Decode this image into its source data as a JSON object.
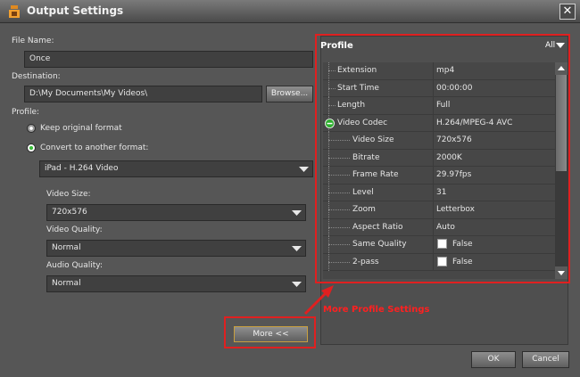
{
  "window": {
    "title": "Output Settings",
    "close_label": "✕"
  },
  "form": {
    "file_name_label": "File Name:",
    "file_name_value": "Once",
    "destination_label": "Destination:",
    "destination_value": "D:\\My Documents\\My Videos\\",
    "browse_label": "Browse...",
    "profile_label": "Profile:",
    "keep_original_label": "Keep original format",
    "convert_label": "Convert to another format:",
    "format_value": "iPad - H.264 Video",
    "video_size_label": "Video Size:",
    "video_size_value": "720x576",
    "video_quality_label": "Video Quality:",
    "video_quality_value": "Normal",
    "audio_quality_label": "Audio Quality:",
    "audio_quality_value": "Normal",
    "more_label": "More <<"
  },
  "profile": {
    "title": "Profile",
    "filter": "All",
    "rows": [
      {
        "key": "Extension",
        "value": "mp4",
        "level": 0
      },
      {
        "key": "Start Time",
        "value": "00:00:00",
        "level": 0
      },
      {
        "key": "Length",
        "value": "Full",
        "level": 0
      },
      {
        "key": "Video Codec",
        "value": "H.264/MPEG-4 AVC",
        "level": 0,
        "expander": true
      },
      {
        "key": "Video Size",
        "value": "720x576",
        "level": 1
      },
      {
        "key": "Bitrate",
        "value": "2000K",
        "level": 1
      },
      {
        "key": "Frame Rate",
        "value": "29.97fps",
        "level": 1
      },
      {
        "key": "Level",
        "value": "31",
        "level": 1
      },
      {
        "key": "Zoom",
        "value": "Letterbox",
        "level": 1
      },
      {
        "key": "Aspect Ratio",
        "value": "Auto",
        "level": 1
      },
      {
        "key": "Same Quality",
        "value": "False",
        "level": 1,
        "checkbox": true
      },
      {
        "key": "2-pass",
        "value": "False",
        "level": 1,
        "checkbox": true
      }
    ]
  },
  "annotation": {
    "text": "More Profile Settings"
  },
  "footer": {
    "ok_label": "OK",
    "cancel_label": "Cancel"
  },
  "colors": {
    "accent": "#e02020",
    "radio_selected": "#3cbf3c",
    "expander": "#2fae2f"
  }
}
